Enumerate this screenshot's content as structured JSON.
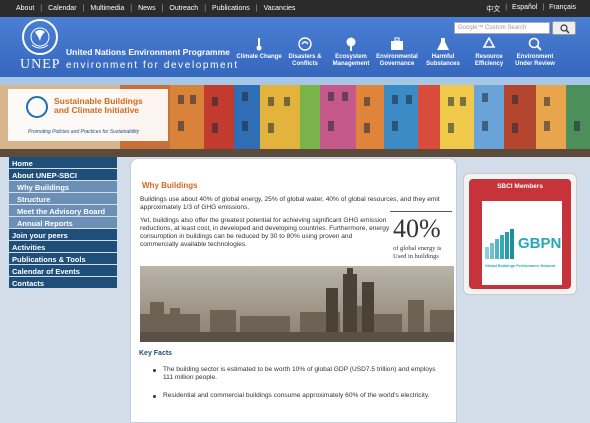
{
  "topnav": [
    "About",
    "Calendar",
    "Multimedia",
    "News",
    "Outreach",
    "Publications",
    "Vacancies"
  ],
  "languages": [
    "中文",
    "Español",
    "Français"
  ],
  "search": {
    "placeholder": "Google™ Custom Search",
    "button_icon": "search-icon"
  },
  "header": {
    "logo_text": "UNEP",
    "title": "United Nations Environment Programme",
    "subtitle": "environment for development"
  },
  "topics": [
    {
      "label": "Climate Change",
      "icon": "thermometer-icon"
    },
    {
      "label": "Disasters & Conflicts",
      "icon": "hands-icon"
    },
    {
      "label": "Ecosystem Management",
      "icon": "tree-icon"
    },
    {
      "label": "Environmental Governance",
      "icon": "briefcase-icon"
    },
    {
      "label": "Harmful Substances",
      "icon": "flask-icon"
    },
    {
      "label": "Resource Efficiency",
      "icon": "recycle-icon"
    },
    {
      "label": "Environment Under Review",
      "icon": "magnifier-icon"
    }
  ],
  "banner": {
    "initiative_name_1": "Sustainable Buildings",
    "initiative_name_2": "and Climate Initiative",
    "tagline": "Promoting Policies and Practices for Sustainability"
  },
  "sidebar": [
    {
      "label": "Home",
      "level": "top"
    },
    {
      "label": "About UNEP-SBCI",
      "level": "top"
    },
    {
      "label": "Why Buildings",
      "level": "sub"
    },
    {
      "label": "Structure",
      "level": "sub"
    },
    {
      "label": "Meet the Advisory Board",
      "level": "sub"
    },
    {
      "label": "Annual Reports",
      "level": "sub"
    },
    {
      "label": "Join your peers",
      "level": "top"
    },
    {
      "label": "Activities",
      "level": "top"
    },
    {
      "label": "Publications & Tools",
      "level": "top"
    },
    {
      "label": "Calendar of Events",
      "level": "top"
    },
    {
      "label": "Contacts",
      "level": "top"
    }
  ],
  "main": {
    "heading": "Why Buildings",
    "para1": "Buildings use about 40% of global energy, 25% of global water, 40% of global resources, and they emit approximately 1/3 of GHG emissions.",
    "para2": "Yet, buildings also offer the greatest potential for achieving significant GHG emission reductions, at least cost, in developed and developing countries. Furthermore, energy consumption in buildings can be reduced by 30 to 80% using proven and commercially available technologies.",
    "stat_value": "40%",
    "stat_caption": "of global energy is Used in buildings",
    "key_facts_title": "Key Facts",
    "facts": [
      "The building sector is estimated to be worth 10% of global GDP (USD7.5 trillion) and employs 111 million people.",
      "Residential and commercial buildings consume approximately 60% of the world's electricity."
    ]
  },
  "members": {
    "title": "SBCI Members",
    "partner_logo": "GBPN",
    "partner_name": "Global Buildings Performance Network"
  }
}
